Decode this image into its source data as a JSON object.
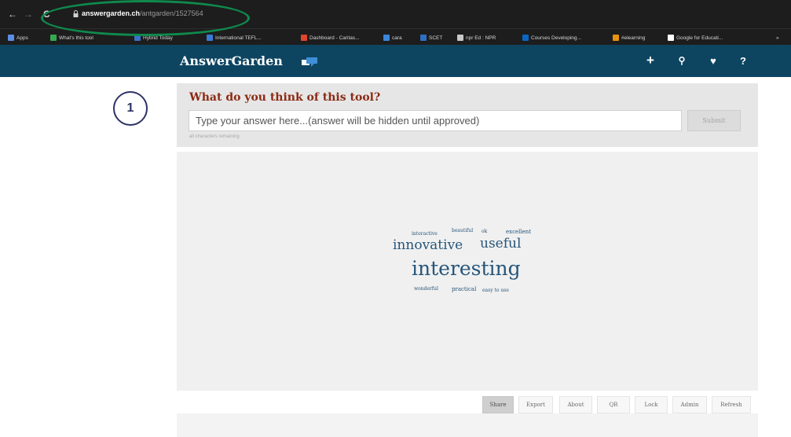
{
  "browser": {
    "url_host": "answergarden.ch",
    "url_path": "/antgarden/1527564",
    "bookmarks": [
      {
        "label": "Apps",
        "color": "#5c8ee6"
      },
      {
        "label": "What's this tool",
        "color": "#36a852"
      },
      {
        "label": "Hybrid Today",
        "color": "#3b71c8"
      },
      {
        "label": "International TEFL...",
        "color": "#3a7ad6"
      },
      {
        "label": "Dashboard - Caritas...",
        "color": "#e0452e"
      },
      {
        "label": "cara",
        "color": "#3b86d9"
      },
      {
        "label": "SCET",
        "color": "#2f6fc2"
      },
      {
        "label": "npr Ed : NPR",
        "color": "#c9c9c9"
      },
      {
        "label": "Courses Developing...",
        "color": "#0a66c2"
      },
      {
        "label": "#elearning",
        "color": "#e8920e"
      },
      {
        "label": "Google for Educati...",
        "color": "#ffffff"
      }
    ]
  },
  "app": {
    "title": "AnswerGarden",
    "header_icons": [
      "plus-icon",
      "search-icon",
      "heart-icon",
      "help-icon"
    ],
    "header_symbols": [
      "+",
      "⚲",
      "♥",
      "?"
    ],
    "brand_color": "#0d4561"
  },
  "step": {
    "number": "1",
    "color": "#2e3266"
  },
  "question": {
    "title": "What do you think of this tool?",
    "placeholder": "Type your answer here...(answer will be hidden until approved)",
    "submit_label": "Submit",
    "char_note": "all characters remaining"
  },
  "cloud": {
    "words": [
      {
        "text": "interactive"
      },
      {
        "text": "beautiful"
      },
      {
        "text": "ok"
      },
      {
        "text": "excellent"
      },
      {
        "text": "innovative"
      },
      {
        "text": "useful"
      },
      {
        "text": "interesting"
      },
      {
        "text": "wonderful"
      },
      {
        "text": "practical"
      },
      {
        "text": "easy to use"
      }
    ]
  },
  "toolbar": {
    "buttons": [
      "Share",
      "Export",
      "About",
      "QR",
      "Lock",
      "Admin",
      "Refresh"
    ],
    "active": "Share"
  },
  "highlight_color": "#0f8a4d"
}
